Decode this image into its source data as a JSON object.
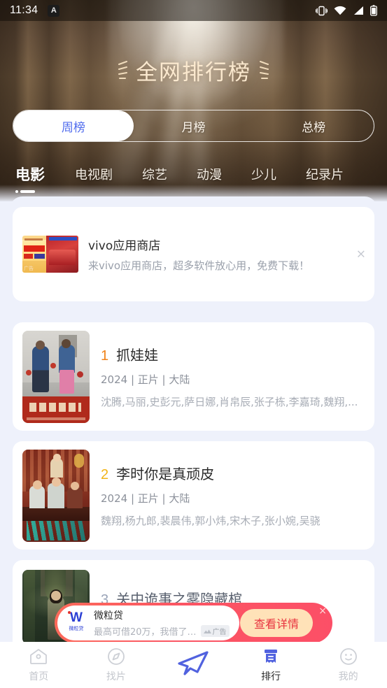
{
  "statusbar": {
    "time": "11:34",
    "badge": "A",
    "icons": [
      "vibrate-icon",
      "wifi-icon",
      "signal-icon",
      "battery-icon"
    ]
  },
  "header": {
    "title": "全网排行榜",
    "decor_left": "laurel-left-icon",
    "decor_right": "laurel-right-icon"
  },
  "period_tabs": {
    "items": [
      {
        "label": "周榜",
        "active": true
      },
      {
        "label": "月榜",
        "active": false
      },
      {
        "label": "总榜",
        "active": false
      }
    ],
    "active_color": "#4f6bed"
  },
  "category_tabs": {
    "items": [
      {
        "label": "电影",
        "active": true
      },
      {
        "label": "电视剧",
        "active": false
      },
      {
        "label": "综艺",
        "active": false
      },
      {
        "label": "动漫",
        "active": false
      },
      {
        "label": "少儿",
        "active": false
      },
      {
        "label": "纪录片",
        "active": false
      }
    ]
  },
  "ad_card": {
    "title": "vivo应用商店",
    "subtitle": "来vivo应用商店，超多软件放心用，免费下载！",
    "thumb_label": "广告",
    "close": "×"
  },
  "ranking": {
    "items": [
      {
        "rank": "1",
        "rank_color": "#f08219",
        "title": "抓娃娃",
        "meta": "2024 | 正片 | 大陆",
        "cast": "沈腾,马丽,史彭元,萨日娜,肖帛辰,张子栋,李嘉琦,魏翔,..."
      },
      {
        "rank": "2",
        "rank_color": "#f2b417",
        "title": "李时你是真顽皮",
        "meta": "2024 | 正片 | 大陆",
        "cast": "魏翔,杨九郎,裴晨伟,郭小炜,宋木子,张小婉,吴骁"
      },
      {
        "rank": "3",
        "rank_color": "#9aa4b8",
        "title": "关中诡事之雾隐藏棺",
        "meta": "",
        "cast": ""
      }
    ]
  },
  "floating_ad": {
    "title": "微粒贷",
    "subtitle": "最高可借20万，我借了…",
    "badge": "广告",
    "button": "查看详情",
    "logo_text": "W",
    "logo_caption": "微粒贷",
    "close": "×",
    "bg_color": "#fc5563",
    "button_color": "#ffe2b8",
    "button_text_color": "#e8343f"
  },
  "bottom_nav": {
    "items": [
      {
        "label": "首页",
        "icon": "home-icon",
        "active": false
      },
      {
        "label": "找片",
        "icon": "compass-icon",
        "active": false
      },
      {
        "label": "",
        "icon": "paper-plane-icon",
        "active": false
      },
      {
        "label": "排行",
        "icon": "ranking-icon",
        "active": true
      },
      {
        "label": "我的",
        "icon": "smiley-face-icon",
        "active": false
      }
    ],
    "active_color": "#4f6bed"
  }
}
